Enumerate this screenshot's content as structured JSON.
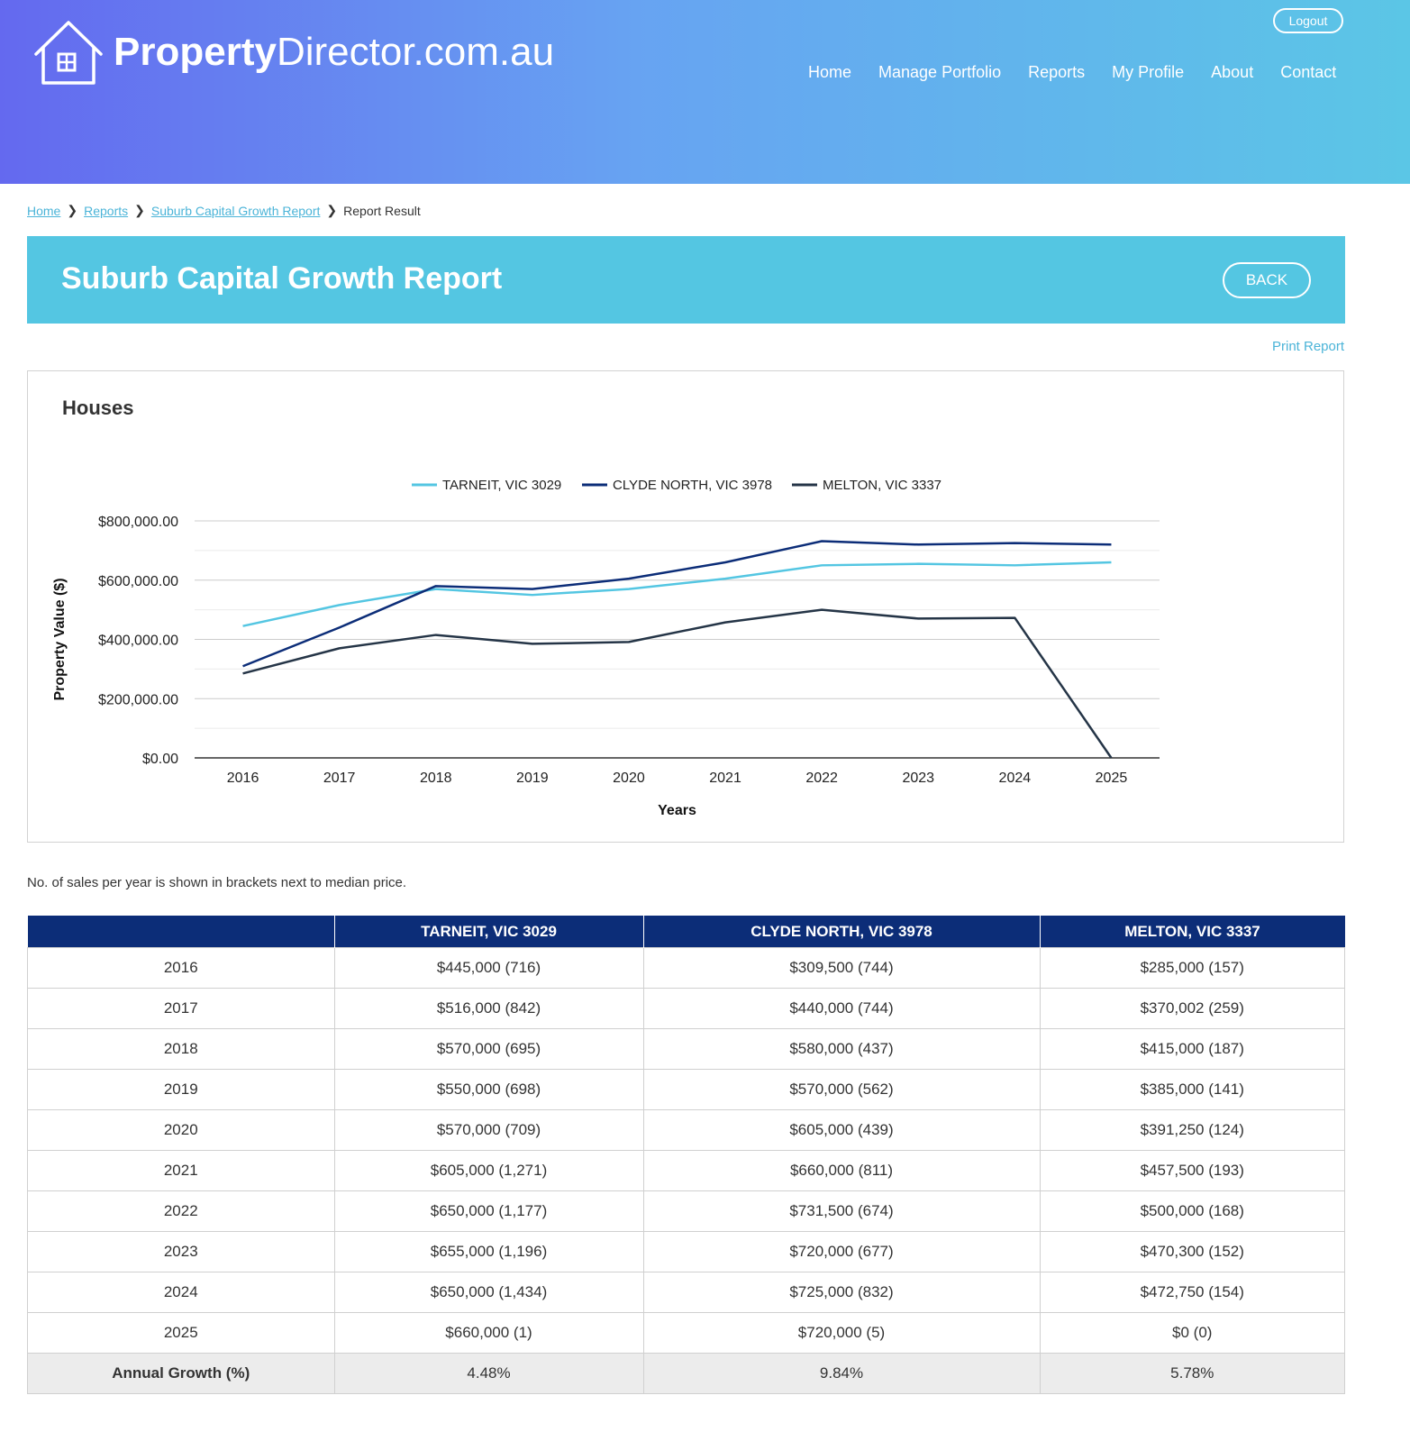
{
  "header": {
    "logo_bold": "Property",
    "logo_rest": "Director.com.au",
    "logout_label": "Logout",
    "nav": [
      "Home",
      "Manage Portfolio",
      "Reports",
      "My Profile",
      "About",
      "Contact"
    ]
  },
  "breadcrumb": {
    "items": [
      "Home",
      "Reports",
      "Suburb Capital Growth Report"
    ],
    "current": "Report Result"
  },
  "page": {
    "title": "Suburb Capital Growth Report",
    "back_label": "BACK",
    "print_label": "Print Report",
    "chart_heading": "Houses",
    "note": "No. of sales per year is shown in brackets next to median price."
  },
  "colors": {
    "accent": "#54c6e2",
    "table_header": "#0c2d78",
    "series": [
      "#54c6e2",
      "#0c2d78",
      "#253547"
    ]
  },
  "chart_data": {
    "type": "line",
    "title": "",
    "xlabel": "Years",
    "ylabel": "Property Value ($)",
    "x": [
      "2016",
      "2017",
      "2018",
      "2019",
      "2020",
      "2021",
      "2022",
      "2023",
      "2024",
      "2025"
    ],
    "ylim": [
      0,
      800000
    ],
    "yticks": [
      "$0.00",
      "$200,000.00",
      "$400,000.00",
      "$600,000.00",
      "$800,000.00"
    ],
    "legend_position": "top",
    "series": [
      {
        "name": "TARNEIT, VIC 3029",
        "values": [
          445000,
          516000,
          570000,
          550000,
          570000,
          605000,
          650000,
          655000,
          650000,
          660000
        ]
      },
      {
        "name": "CLYDE NORTH, VIC 3978",
        "values": [
          309500,
          440000,
          580000,
          570000,
          605000,
          660000,
          731500,
          720000,
          725000,
          720000
        ]
      },
      {
        "name": "MELTON, VIC 3337",
        "values": [
          285000,
          370002,
          415000,
          385000,
          391250,
          457500,
          500000,
          470300,
          472750,
          0
        ]
      }
    ]
  },
  "table": {
    "headers": [
      "",
      "TARNEIT, VIC 3029",
      "CLYDE NORTH, VIC 3978",
      "MELTON, VIC 3337"
    ],
    "rows": [
      [
        "2016",
        "$445,000 (716)",
        "$309,500 (744)",
        "$285,000 (157)"
      ],
      [
        "2017",
        "$516,000 (842)",
        "$440,000 (744)",
        "$370,002 (259)"
      ],
      [
        "2018",
        "$570,000 (695)",
        "$580,000 (437)",
        "$415,000 (187)"
      ],
      [
        "2019",
        "$550,000 (698)",
        "$570,000 (562)",
        "$385,000 (141)"
      ],
      [
        "2020",
        "$570,000 (709)",
        "$605,000 (439)",
        "$391,250 (124)"
      ],
      [
        "2021",
        "$605,000 (1,271)",
        "$660,000 (811)",
        "$457,500 (193)"
      ],
      [
        "2022",
        "$650,000 (1,177)",
        "$731,500 (674)",
        "$500,000 (168)"
      ],
      [
        "2023",
        "$655,000 (1,196)",
        "$720,000 (677)",
        "$470,300 (152)"
      ],
      [
        "2024",
        "$650,000 (1,434)",
        "$725,000 (832)",
        "$472,750 (154)"
      ],
      [
        "2025",
        "$660,000 (1)",
        "$720,000 (5)",
        "$0 (0)"
      ]
    ],
    "growth": [
      "Annual Growth (%)",
      "4.48%",
      "9.84%",
      "5.78%"
    ]
  }
}
